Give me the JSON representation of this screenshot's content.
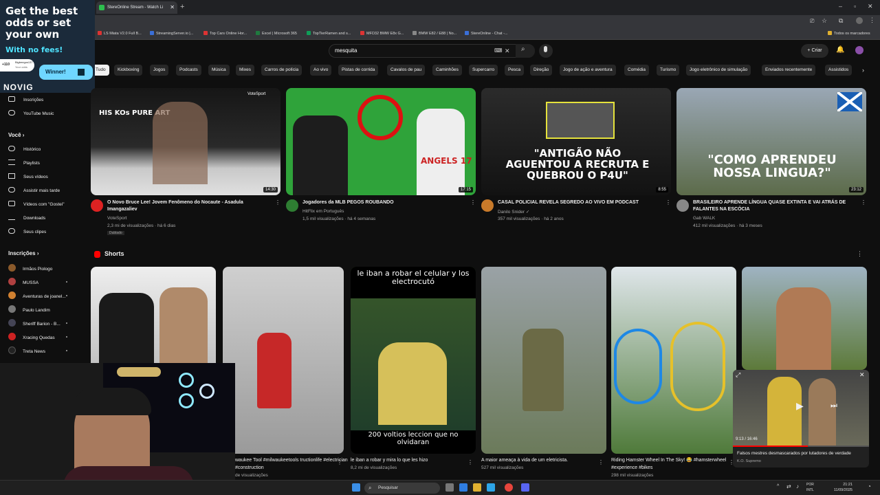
{
  "browser": {
    "tab_title": "StereOnline Stream - Watch Li",
    "bookmarks": [
      "LS Miata V2.0 Full B...",
      "StreamingServer.io |...",
      "Top Cars Online Hor...",
      "Excel | Microsoft 365",
      "TopTierRamen and s...",
      "MFD32 BMW E8x G...",
      "BMW E82 / E88 | No...",
      "StereOnline - Chat -..."
    ],
    "all_bookmarks": "Todos os marcadores"
  },
  "youtube": {
    "search_value": "mesquita",
    "create_label": "Criar",
    "chips": [
      "Tudo",
      "Kickboxing",
      "Jogos",
      "Podcasts",
      "Música",
      "Mixes",
      "Carros de polícia",
      "Ao vivo",
      "Pistas de corrida",
      "Cavalos de pau",
      "Caminhões",
      "Supercarro",
      "Pesca",
      "Direção",
      "Jogo de ação e aventura",
      "Comédia",
      "Turismo",
      "Jogo eletrônico de simulação",
      "Enviados recentemente",
      "Assistidos"
    ]
  },
  "sidebar": {
    "top_items": [
      "Inscrições",
      "YouTube Music"
    ],
    "you_heading": "Você",
    "you_items": [
      "Histórico",
      "Playlists",
      "Seus vídeos",
      "Assistir mais tarde",
      "Vídeos com \"Gostei\"",
      "Downloads",
      "Seus clipes"
    ],
    "subs_heading": "Inscrições",
    "subs": [
      "Irmãos Piologo",
      "MUSSA",
      "Aventuras de joanel...",
      "Paulo Landim",
      "Sheriff Barion - B...",
      "Xracing Quedas",
      "Treta News"
    ]
  },
  "ad": {
    "headline": "Get the best odds or set your own",
    "sub": "With no fees!",
    "winner": "Winner!",
    "pill_amount": "+110",
    "pill_user": "Bigbeegus137",
    "pill_sub": "Your odds",
    "brand": "NOVIG"
  },
  "videos": [
    {
      "title": "O Novo Bruce Lee! Jovem Fenômeno do Nocaute - Asadula Imangazaliev",
      "channel": "VoteSport",
      "meta": "2,3 mi de visualizações · há 6 dias",
      "badge": "Dublado",
      "duration": "14:30",
      "thumb_text": "HIS KOs PURE ART",
      "logo": "VoteSport"
    },
    {
      "title": "Jogadores da MLB PEGOS ROUBANDO",
      "channel": "HitFlix em Português",
      "meta": "1,5 mil visualizações · há 4 semanas",
      "duration": "17:15",
      "thumb_text": "ANGELS 17"
    },
    {
      "title": "CASAL POLICIAL REVELA SEGREDO AO VIVO EM PODCAST",
      "channel": "Danilo Snider ✓",
      "meta": "357 mil visualizações · há 2 anos",
      "duration": "8:55",
      "thumb_text": "\"ANTIGÃO NÃO AGUENTOU A RECRUTA E QUEBROU O P4U\""
    },
    {
      "title": "BRASILEIRO APRENDE LÍNGUA QUASE EXTINTA E VAI ATRÁS DE FALANTES NA ESCÓCIA",
      "channel": "Gab WALK",
      "meta": "412 mil visualizações · há 3 meses",
      "duration": "23:12",
      "thumb_text": "\"COMO APRENDEU NOSSA LINGUA?\""
    }
  ],
  "shorts": {
    "heading": "Shorts",
    "items": [
      {
        "title": "",
        "views": ""
      },
      {
        "title": "waukee Tool #milwaukeetools tructionlife #electrician #construction",
        "views": "de visualizações"
      },
      {
        "title": "le iban a robar y mira lo que les hizo",
        "views": "8,2 mi de visualizações",
        "top_text": "le iban a robar el celular y los electrocutó",
        "bottom_text": "200 voltios leccion que no olvidaran"
      },
      {
        "title": "A maior ameaça à vida de um eletricista.",
        "views": "527 mil visualizações"
      },
      {
        "title": "Riding Hamster Wheel In The Sky! 😂 #hamsterwheel #experience #bikes",
        "views": "298 mil visualizações"
      },
      {
        "title": "",
        "views": ""
      }
    ]
  },
  "miniplayer": {
    "time": "9:13 / 16:46",
    "title": "Falsos mestres desmascarados por lutadores de verdade",
    "channel": "K.O. Supremo"
  },
  "taskbar": {
    "search": "Pesquisar",
    "lang_top": "POR",
    "lang_bottom": "INTL",
    "time": "21:21",
    "date": "11/09/2025"
  }
}
